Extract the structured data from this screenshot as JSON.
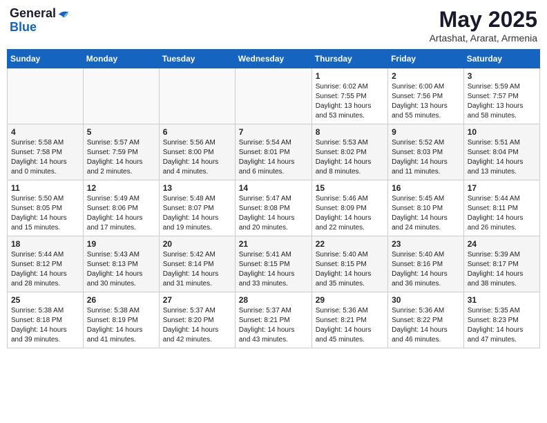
{
  "header": {
    "logo_general": "General",
    "logo_blue": "Blue",
    "title": "May 2025",
    "location": "Artashat, Ararat, Armenia"
  },
  "days_of_week": [
    "Sunday",
    "Monday",
    "Tuesday",
    "Wednesday",
    "Thursday",
    "Friday",
    "Saturday"
  ],
  "weeks": [
    [
      {
        "day": "",
        "info": ""
      },
      {
        "day": "",
        "info": ""
      },
      {
        "day": "",
        "info": ""
      },
      {
        "day": "",
        "info": ""
      },
      {
        "day": "1",
        "info": "Sunrise: 6:02 AM\nSunset: 7:55 PM\nDaylight: 13 hours\nand 53 minutes."
      },
      {
        "day": "2",
        "info": "Sunrise: 6:00 AM\nSunset: 7:56 PM\nDaylight: 13 hours\nand 55 minutes."
      },
      {
        "day": "3",
        "info": "Sunrise: 5:59 AM\nSunset: 7:57 PM\nDaylight: 13 hours\nand 58 minutes."
      }
    ],
    [
      {
        "day": "4",
        "info": "Sunrise: 5:58 AM\nSunset: 7:58 PM\nDaylight: 14 hours\nand 0 minutes."
      },
      {
        "day": "5",
        "info": "Sunrise: 5:57 AM\nSunset: 7:59 PM\nDaylight: 14 hours\nand 2 minutes."
      },
      {
        "day": "6",
        "info": "Sunrise: 5:56 AM\nSunset: 8:00 PM\nDaylight: 14 hours\nand 4 minutes."
      },
      {
        "day": "7",
        "info": "Sunrise: 5:54 AM\nSunset: 8:01 PM\nDaylight: 14 hours\nand 6 minutes."
      },
      {
        "day": "8",
        "info": "Sunrise: 5:53 AM\nSunset: 8:02 PM\nDaylight: 14 hours\nand 8 minutes."
      },
      {
        "day": "9",
        "info": "Sunrise: 5:52 AM\nSunset: 8:03 PM\nDaylight: 14 hours\nand 11 minutes."
      },
      {
        "day": "10",
        "info": "Sunrise: 5:51 AM\nSunset: 8:04 PM\nDaylight: 14 hours\nand 13 minutes."
      }
    ],
    [
      {
        "day": "11",
        "info": "Sunrise: 5:50 AM\nSunset: 8:05 PM\nDaylight: 14 hours\nand 15 minutes."
      },
      {
        "day": "12",
        "info": "Sunrise: 5:49 AM\nSunset: 8:06 PM\nDaylight: 14 hours\nand 17 minutes."
      },
      {
        "day": "13",
        "info": "Sunrise: 5:48 AM\nSunset: 8:07 PM\nDaylight: 14 hours\nand 19 minutes."
      },
      {
        "day": "14",
        "info": "Sunrise: 5:47 AM\nSunset: 8:08 PM\nDaylight: 14 hours\nand 20 minutes."
      },
      {
        "day": "15",
        "info": "Sunrise: 5:46 AM\nSunset: 8:09 PM\nDaylight: 14 hours\nand 22 minutes."
      },
      {
        "day": "16",
        "info": "Sunrise: 5:45 AM\nSunset: 8:10 PM\nDaylight: 14 hours\nand 24 minutes."
      },
      {
        "day": "17",
        "info": "Sunrise: 5:44 AM\nSunset: 8:11 PM\nDaylight: 14 hours\nand 26 minutes."
      }
    ],
    [
      {
        "day": "18",
        "info": "Sunrise: 5:44 AM\nSunset: 8:12 PM\nDaylight: 14 hours\nand 28 minutes."
      },
      {
        "day": "19",
        "info": "Sunrise: 5:43 AM\nSunset: 8:13 PM\nDaylight: 14 hours\nand 30 minutes."
      },
      {
        "day": "20",
        "info": "Sunrise: 5:42 AM\nSunset: 8:14 PM\nDaylight: 14 hours\nand 31 minutes."
      },
      {
        "day": "21",
        "info": "Sunrise: 5:41 AM\nSunset: 8:15 PM\nDaylight: 14 hours\nand 33 minutes."
      },
      {
        "day": "22",
        "info": "Sunrise: 5:40 AM\nSunset: 8:15 PM\nDaylight: 14 hours\nand 35 minutes."
      },
      {
        "day": "23",
        "info": "Sunrise: 5:40 AM\nSunset: 8:16 PM\nDaylight: 14 hours\nand 36 minutes."
      },
      {
        "day": "24",
        "info": "Sunrise: 5:39 AM\nSunset: 8:17 PM\nDaylight: 14 hours\nand 38 minutes."
      }
    ],
    [
      {
        "day": "25",
        "info": "Sunrise: 5:38 AM\nSunset: 8:18 PM\nDaylight: 14 hours\nand 39 minutes."
      },
      {
        "day": "26",
        "info": "Sunrise: 5:38 AM\nSunset: 8:19 PM\nDaylight: 14 hours\nand 41 minutes."
      },
      {
        "day": "27",
        "info": "Sunrise: 5:37 AM\nSunset: 8:20 PM\nDaylight: 14 hours\nand 42 minutes."
      },
      {
        "day": "28",
        "info": "Sunrise: 5:37 AM\nSunset: 8:21 PM\nDaylight: 14 hours\nand 43 minutes."
      },
      {
        "day": "29",
        "info": "Sunrise: 5:36 AM\nSunset: 8:21 PM\nDaylight: 14 hours\nand 45 minutes."
      },
      {
        "day": "30",
        "info": "Sunrise: 5:36 AM\nSunset: 8:22 PM\nDaylight: 14 hours\nand 46 minutes."
      },
      {
        "day": "31",
        "info": "Sunrise: 5:35 AM\nSunset: 8:23 PM\nDaylight: 14 hours\nand 47 minutes."
      }
    ]
  ]
}
